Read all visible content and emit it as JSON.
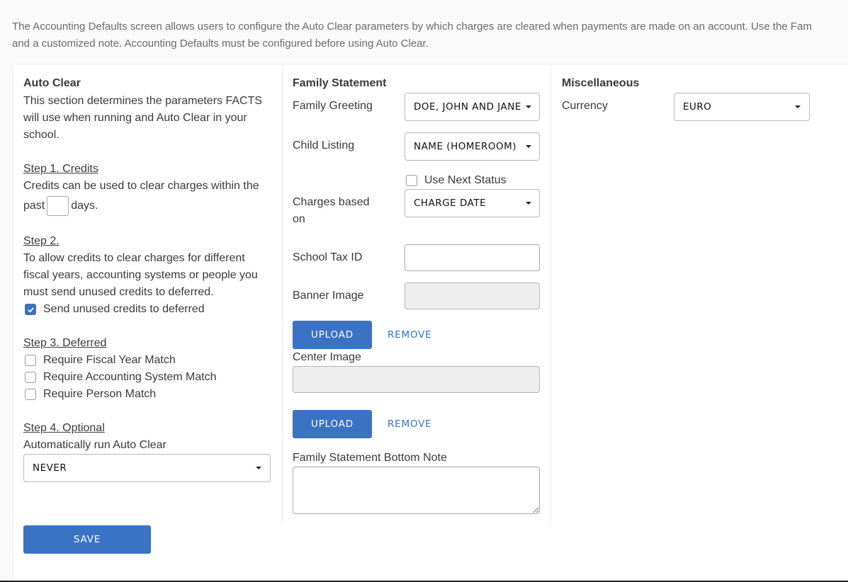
{
  "intro": {
    "line1": "The Accounting Defaults screen allows users to configure the Auto Clear parameters by which charges are cleared when payments are made on an account. Use the Fam",
    "line2": "and a customized note. Accounting Defaults must be configured before using Auto Clear."
  },
  "auto_clear": {
    "title": "Auto Clear",
    "description": "This section determines the parameters FACTS will use when running and Auto Clear in your school.",
    "step1": {
      "heading": "Step 1. Credits",
      "text": "Credits can be used to clear charges within the",
      "prefix": "past",
      "days_value": "",
      "suffix": "days."
    },
    "step2": {
      "heading": "Step 2.",
      "text": "To allow credits to clear charges for different fiscal years, accounting systems or people you must send unused credits to deferred.",
      "checkbox_label": "Send unused credits to deferred",
      "checked": true
    },
    "step3": {
      "heading": "Step 3. Deferred",
      "options": [
        {
          "label": "Require Fiscal Year Match",
          "checked": false
        },
        {
          "label": "Require Accounting System Match",
          "checked": false
        },
        {
          "label": "Require Person Match",
          "checked": false
        }
      ]
    },
    "step4": {
      "heading": "Step 4. Optional",
      "text": "Automatically run Auto Clear",
      "selected": "NEVER"
    },
    "save_label": "SAVE"
  },
  "family_statement": {
    "title": "Family Statement",
    "family_greeting_label": "Family Greeting",
    "family_greeting_value": "DOE, JOHN AND JANE",
    "child_listing_label": "Child Listing",
    "child_listing_value": "NAME (HOMEROOM)",
    "use_next_status_label": "Use Next Status",
    "use_next_status_checked": false,
    "charges_based_on_label_1": "Charges based",
    "charges_based_on_label_2": "on",
    "charges_based_on_value": "CHARGE DATE",
    "school_tax_id_label": "School Tax ID",
    "school_tax_id_value": "",
    "banner_image_label": "Banner Image",
    "upload_label": "UPLOAD",
    "remove_label": "REMOVE",
    "center_image_label": "Center Image",
    "bottom_note_label": "Family Statement Bottom Note",
    "bottom_note_value": ""
  },
  "miscellaneous": {
    "title": "Miscellaneous",
    "currency_label": "Currency",
    "currency_value": "EURO"
  },
  "colors": {
    "primary": "#3a72c4"
  }
}
